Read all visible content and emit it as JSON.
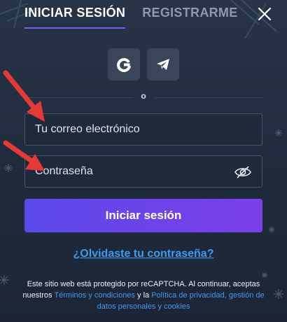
{
  "tabs": [
    {
      "label": "INICIAR SESIÓN",
      "active": true
    },
    {
      "label": "REGISTRARME",
      "active": false
    }
  ],
  "social": [
    {
      "name": "google-logo-icon"
    },
    {
      "name": "telegram-icon"
    }
  ],
  "divider": {
    "text": "o"
  },
  "form": {
    "email_placeholder": "Tu correo electrónico",
    "email_value": "",
    "password_placeholder": "Contraseña",
    "password_value": "",
    "submit_label": "Iniciar sesión"
  },
  "forgot_link": "¿Olvidaste tu contraseña?",
  "legal": {
    "text_part1": "Este sitio web está protegido por reCAPTCHA. Al continuar, aceptas nuestros",
    "link_terms": "Términos y condiciones",
    "text_and": "y la",
    "link_privacy": "Política de privacidad, gestión de datos personales y cookies"
  },
  "colors": {
    "background": "#232f42",
    "accent": "#7c5cf5",
    "button_gradient_start": "#5b49ea",
    "button_gradient_end": "#7b3fe7",
    "link": "#3d9bf0",
    "annotation_arrow": "#e53935"
  },
  "annotations": [
    {
      "name": "red-arrow-icon",
      "points_to": "email-field"
    },
    {
      "name": "red-arrow-icon",
      "points_to": "password-field"
    }
  ]
}
